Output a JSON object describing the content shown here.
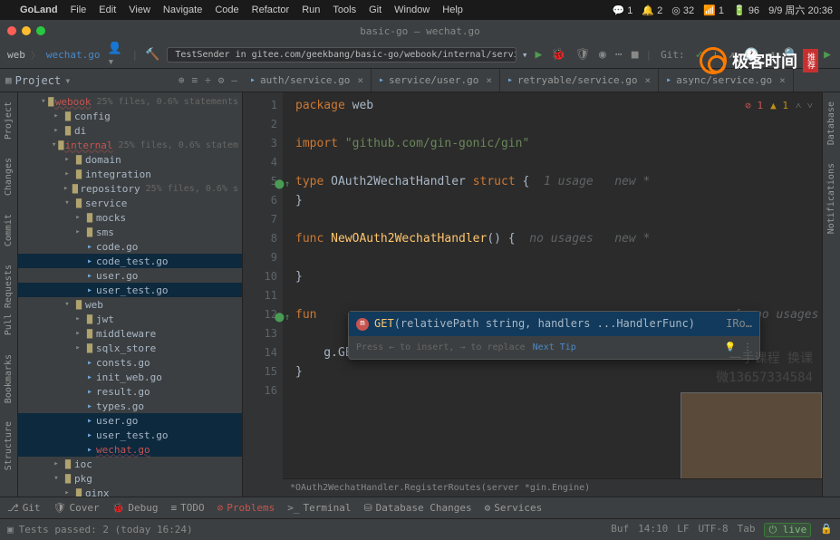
{
  "mac": {
    "app": "GoLand",
    "menus": [
      "File",
      "Edit",
      "View",
      "Navigate",
      "Code",
      "Refactor",
      "Run",
      "Tools",
      "Git",
      "Window",
      "Help"
    ],
    "right": {
      "msg": "1",
      "bell": "2",
      "ring": "32",
      "sig": "1",
      "batt": "96",
      "date": "9/9 周六 20:36"
    }
  },
  "title": "basic-go — wechat.go",
  "crumbs": {
    "root": "web",
    "file": "wechat.go"
  },
  "runconfig": "TestSender in gitee.com/geekbang/basic-go/webook/internal/service/sms/tencent",
  "git_label": "Git:",
  "tabs": [
    {
      "label": "auth/service.go"
    },
    {
      "label": "service/user.go"
    },
    {
      "label": "retryable/service.go"
    },
    {
      "label": "async/service.go"
    }
  ],
  "panel_title": "Project",
  "tree": [
    {
      "depth": 2,
      "arrow": "v",
      "icon": "folder",
      "name": "webook",
      "cls": "red",
      "hint": "25% files, 0.6% statements"
    },
    {
      "depth": 3,
      "arrow": ">",
      "icon": "folder",
      "name": "config"
    },
    {
      "depth": 3,
      "arrow": ">",
      "icon": "folder",
      "name": "di"
    },
    {
      "depth": 3,
      "arrow": "v",
      "icon": "folder",
      "name": "internal",
      "cls": "red",
      "hint": "25% files, 0.6% statem"
    },
    {
      "depth": 4,
      "arrow": ">",
      "icon": "folder",
      "name": "domain"
    },
    {
      "depth": 4,
      "arrow": ">",
      "icon": "folder",
      "name": "integration"
    },
    {
      "depth": 4,
      "arrow": ">",
      "icon": "folder",
      "name": "repository",
      "hint": "25% files, 0.6% s"
    },
    {
      "depth": 4,
      "arrow": "v",
      "icon": "folder",
      "name": "service"
    },
    {
      "depth": 5,
      "arrow": ">",
      "icon": "folder",
      "name": "mocks"
    },
    {
      "depth": 5,
      "arrow": ">",
      "icon": "folder",
      "name": "sms"
    },
    {
      "depth": 5,
      "arrow": "",
      "icon": "go",
      "name": "code.go"
    },
    {
      "depth": 5,
      "arrow": "",
      "icon": "go",
      "name": "code_test.go",
      "sel": true
    },
    {
      "depth": 5,
      "arrow": "",
      "icon": "go",
      "name": "user.go"
    },
    {
      "depth": 5,
      "arrow": "",
      "icon": "go",
      "name": "user_test.go",
      "sel": true
    },
    {
      "depth": 4,
      "arrow": "v",
      "icon": "folder",
      "name": "web"
    },
    {
      "depth": 5,
      "arrow": ">",
      "icon": "folder",
      "name": "jwt"
    },
    {
      "depth": 5,
      "arrow": ">",
      "icon": "folder",
      "name": "middleware"
    },
    {
      "depth": 5,
      "arrow": ">",
      "icon": "folder",
      "name": "sqlx_store"
    },
    {
      "depth": 5,
      "arrow": "",
      "icon": "go",
      "name": "consts.go"
    },
    {
      "depth": 5,
      "arrow": "",
      "icon": "go",
      "name": "init_web.go"
    },
    {
      "depth": 5,
      "arrow": "",
      "icon": "go",
      "name": "result.go"
    },
    {
      "depth": 5,
      "arrow": "",
      "icon": "go",
      "name": "types.go"
    },
    {
      "depth": 5,
      "arrow": "",
      "icon": "go",
      "name": "user.go",
      "sel": true
    },
    {
      "depth": 5,
      "arrow": "",
      "icon": "go",
      "name": "user_test.go",
      "sel": true
    },
    {
      "depth": 5,
      "arrow": "",
      "icon": "go",
      "name": "wechat.go",
      "cls": "red",
      "sel": true
    },
    {
      "depth": 3,
      "arrow": ">",
      "icon": "folder",
      "name": "ioc"
    },
    {
      "depth": 3,
      "arrow": "v",
      "icon": "folder",
      "name": "pkg"
    },
    {
      "depth": 4,
      "arrow": ">",
      "icon": "folder",
      "name": "ginx"
    },
    {
      "depth": 4,
      "arrow": ">",
      "icon": "folder",
      "name": "ratelimit"
    }
  ],
  "hints_top": {
    "err": "1",
    "warn": "1"
  },
  "code": {
    "l1a": "package ",
    "l1b": "web",
    "l3a": "import ",
    "l3b": "\"github.com/gin-gonic/gin\"",
    "l5a": "type ",
    "l5b": "OAuth2WechatHandler ",
    "l5c": "struct ",
    "l5d": "{",
    "l5h": "  1 usage   new *",
    "l6": "}",
    "l8a": "func ",
    "l8b": "NewOAuth2WechatHandler",
    "l8c": "() {",
    "l8h": "  no usages   new *",
    "l10": "}",
    "l12a": "fun",
    "l12h": "{  no usages",
    "l14": "    g.GET",
    "l15": "}"
  },
  "popup": {
    "method": "GET",
    "sig": "(relativePath string, handlers ...HandlerFunc)",
    "ret": "IRo…",
    "hint": "Press ← to insert, → to replace",
    "next": "Next Tip"
  },
  "breadcrumb2": "*OAuth2WechatHandler.RegisterRoutes(server *gin.Engine)",
  "ghost": {
    "l1": "一手课程 换课",
    "l2": "微13657334584"
  },
  "toolwin": [
    {
      "icon": "⎇",
      "label": "Git"
    },
    {
      "icon": "🛡",
      "label": "Cover"
    },
    {
      "icon": "🐞",
      "label": "Debug"
    },
    {
      "icon": "≡",
      "label": "TODO"
    },
    {
      "icon": "⊘",
      "label": "Problems",
      "cls": "twred"
    },
    {
      "icon": ">_",
      "label": "Terminal"
    },
    {
      "icon": "⛁",
      "label": "Database Changes"
    },
    {
      "icon": "⚙",
      "label": "Services"
    }
  ],
  "status": {
    "msg": "Tests passed: 2 (today 16:24)",
    "buf": "Buf",
    "pos": "14:10",
    "lf": "LF",
    "enc": "UTF-8",
    "tab": "Tab",
    "live": "⏻ live"
  },
  "logo": "极客时间"
}
